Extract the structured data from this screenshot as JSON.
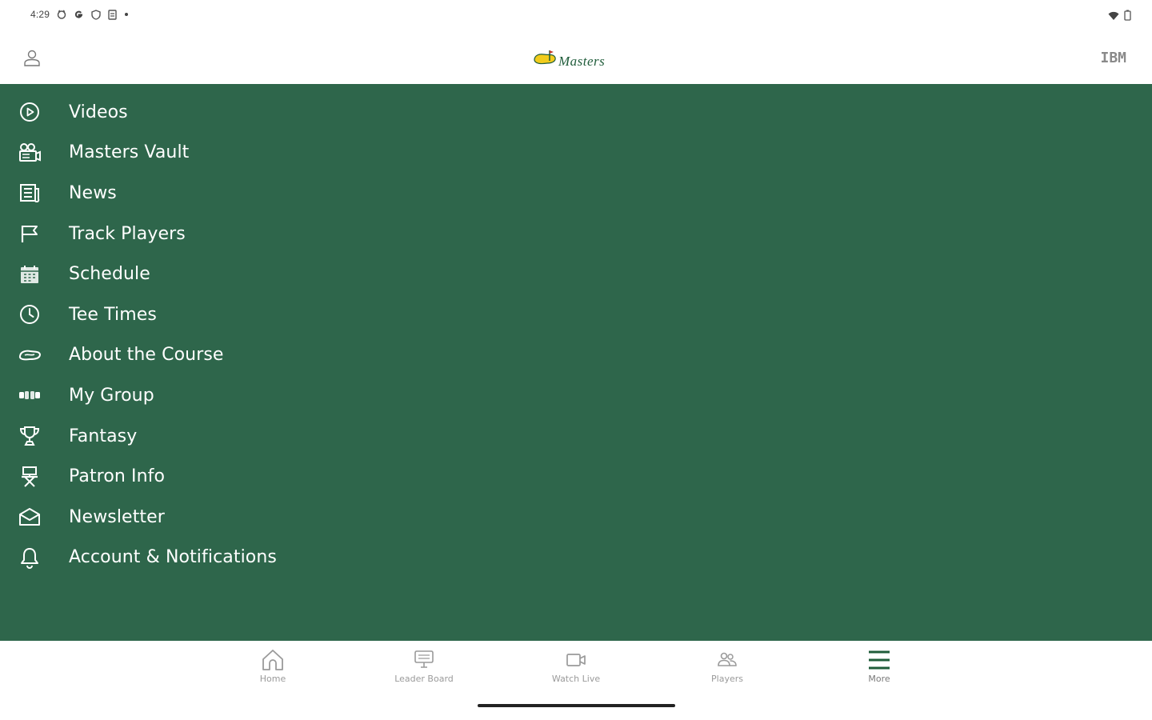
{
  "status_bar": {
    "time": "4:29",
    "notification_icons": [
      "alarm-icon",
      "google-icon",
      "shield-icon",
      "sim-icon",
      "dot-icon"
    ],
    "right_icons": [
      "wifi-icon",
      "battery-icon"
    ]
  },
  "header": {
    "logo_text": "Masters",
    "sponsor": "IBM",
    "profile_icon": "user-icon"
  },
  "menu": {
    "background": "#2e664b",
    "items": [
      {
        "label": "Videos",
        "icon": "play-circle-icon"
      },
      {
        "label": "Masters Vault",
        "icon": "film-camera-icon"
      },
      {
        "label": "News",
        "icon": "newspaper-icon"
      },
      {
        "label": "Track Players",
        "icon": "flag-icon"
      },
      {
        "label": "Schedule",
        "icon": "calendar-icon"
      },
      {
        "label": "Tee Times",
        "icon": "clock-icon"
      },
      {
        "label": "About the Course",
        "icon": "course-icon"
      },
      {
        "label": "My Group",
        "icon": "group-icon"
      },
      {
        "label": "Fantasy",
        "icon": "trophy-icon"
      },
      {
        "label": "Patron Info",
        "icon": "chair-icon"
      },
      {
        "label": "Newsletter",
        "icon": "envelope-icon"
      },
      {
        "label": "Account & Notifications",
        "icon": "bell-icon"
      }
    ]
  },
  "bottom_nav": {
    "items": [
      {
        "label": "Home",
        "icon": "home-icon"
      },
      {
        "label": "Leader Board",
        "icon": "leaderboard-icon"
      },
      {
        "label": "Watch Live",
        "icon": "video-camera-icon"
      },
      {
        "label": "Players",
        "icon": "players-icon"
      },
      {
        "label": "More",
        "icon": "hamburger-menu-icon",
        "active": true
      }
    ],
    "active_color": "#1f5c3a"
  }
}
